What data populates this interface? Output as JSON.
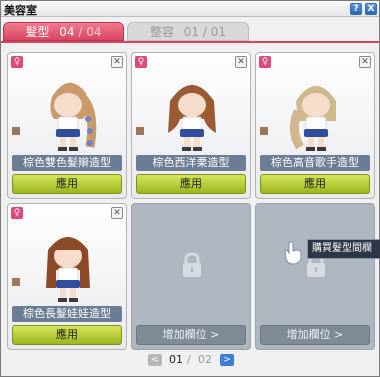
{
  "window": {
    "title": "美容室",
    "help_label": "?",
    "close_label": "X"
  },
  "tabs": [
    {
      "label": "髮型",
      "count": "04",
      "max": "/ 04",
      "active": true
    },
    {
      "label": "整容",
      "count": "01",
      "max": "/ 01",
      "active": false
    }
  ],
  "slots": [
    {
      "name": "棕色雙色髮辮造型",
      "apply_label": "應用",
      "gender": "♀",
      "close": "✕",
      "hair_color": "#c99a6a"
    },
    {
      "name": "棕色西洋栗造型",
      "apply_label": "應用",
      "gender": "♀",
      "close": "✕",
      "hair_color": "#9b5a34"
    },
    {
      "name": "棕色高音歌手造型",
      "apply_label": "應用",
      "gender": "♀",
      "close": "✕",
      "hair_color": "#cfb78e"
    },
    {
      "name": "棕色長髮娃娃造型",
      "apply_label": "應用",
      "gender": "♀",
      "close": "✕",
      "hair_color": "#8c4a28"
    }
  ],
  "locked_slots": [
    {
      "label": "增加欄位 >",
      "icon": "lock-icon"
    },
    {
      "label": "增加欄位 >",
      "icon": "lock-icon"
    }
  ],
  "pager": {
    "current": "01",
    "separator": "/",
    "total": "02",
    "prev": "<",
    "next": ">"
  },
  "tooltip": {
    "text": "購買髮型間欄"
  },
  "colors": {
    "accent": "#d84560",
    "apply": "#b4cc30",
    "name_bar": "#6b7d94",
    "locked": "#aeb6bf"
  }
}
